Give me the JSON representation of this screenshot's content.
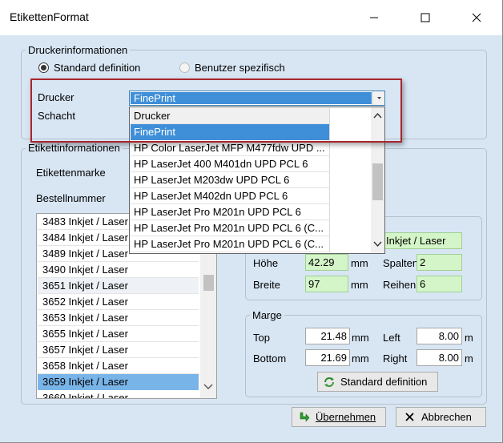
{
  "window": {
    "title": "EtikettenFormat",
    "controls": {
      "minimize_icon": "minimize-icon",
      "maximize_icon": "maximize-icon",
      "close_icon": "close-icon"
    }
  },
  "printer_info": {
    "group_label": "Druckerinformationen",
    "radio_standard": "Standard definition",
    "radio_standard_checked": true,
    "radio_custom": "Benutzer spezifisch",
    "radio_custom_enabled": false,
    "printer_label": "Drucker",
    "tray_label": "Schacht",
    "printer_value": "FinePrint"
  },
  "printer_dropdown": {
    "items": [
      {
        "label": "Drucker",
        "state": "header"
      },
      {
        "label": "FinePrint",
        "state": "selected"
      },
      {
        "label": "HP Color LaserJet MFP M477fdw UPD ...",
        "state": ""
      },
      {
        "label": "HP LaserJet 400 M401dn UPD PCL 6",
        "state": ""
      },
      {
        "label": "HP LaserJet M203dw UPD PCL 6",
        "state": ""
      },
      {
        "label": "HP LaserJet M402dn UPD PCL 6",
        "state": ""
      },
      {
        "label": "HP LaserJet Pro M201n UPD PCL 6",
        "state": ""
      },
      {
        "label": "HP LaserJet Pro M201n UPD PCL 6 (C...",
        "state": ""
      },
      {
        "label": "HP LaserJet Pro M201n UPD PCL 6 (C...",
        "state": ""
      }
    ]
  },
  "label_info": {
    "group_label": "Etikettinformationen",
    "brand_label": "Etikettenmarke",
    "order_number_label": "Bestellnummer",
    "stock_list": [
      {
        "label": "3483 Inkjet / Laser",
        "state": ""
      },
      {
        "label": "3484 Inkjet / Laser",
        "state": ""
      },
      {
        "label": "3489 Inkjet / Laser",
        "state": ""
      },
      {
        "label": "3490 Inkjet / Laser",
        "state": ""
      },
      {
        "label": "3651 Inkjet / Laser",
        "state": "shade"
      },
      {
        "label": "3652 Inkjet / Laser",
        "state": ""
      },
      {
        "label": "3653 Inkjet / Laser",
        "state": ""
      },
      {
        "label": "3655 Inkjet / Laser",
        "state": ""
      },
      {
        "label": "3657 Inkjet / Laser",
        "state": ""
      },
      {
        "label": "3658 Inkjet / Laser",
        "state": ""
      },
      {
        "label": "3659 Inkjet / Laser",
        "state": "selected"
      },
      {
        "label": "3660 Inkjet / Laser",
        "state": ""
      }
    ],
    "type_value": "Inkjet / Laser",
    "height_label": "Höhe",
    "height_value": "42.29",
    "width_label": "Breite",
    "width_value": "97",
    "unit_mm": "mm",
    "columns_label": "Spalten",
    "columns_value": "2",
    "rows_label": "Reihen",
    "rows_value": "6"
  },
  "margin": {
    "group_label": "Marge",
    "top_label": "Top",
    "top_value": "21.48",
    "bottom_label": "Bottom",
    "bottom_value": "21.69",
    "left_label": "Left",
    "left_value": "8.00",
    "right_label": "Right",
    "right_value": "8.00",
    "unit_mm": "mm",
    "unit_m": "m",
    "standard_button": "Standard definition"
  },
  "footer": {
    "apply_button": "Übernehmen",
    "cancel_button": "Abbrechen"
  },
  "colors": {
    "window_background": "#d8e6f4",
    "selection_blue": "#3f8fd8",
    "list_selection": "#79b4e8",
    "field_green": "#d4f5c8",
    "highlight_red": "#a8262c"
  }
}
